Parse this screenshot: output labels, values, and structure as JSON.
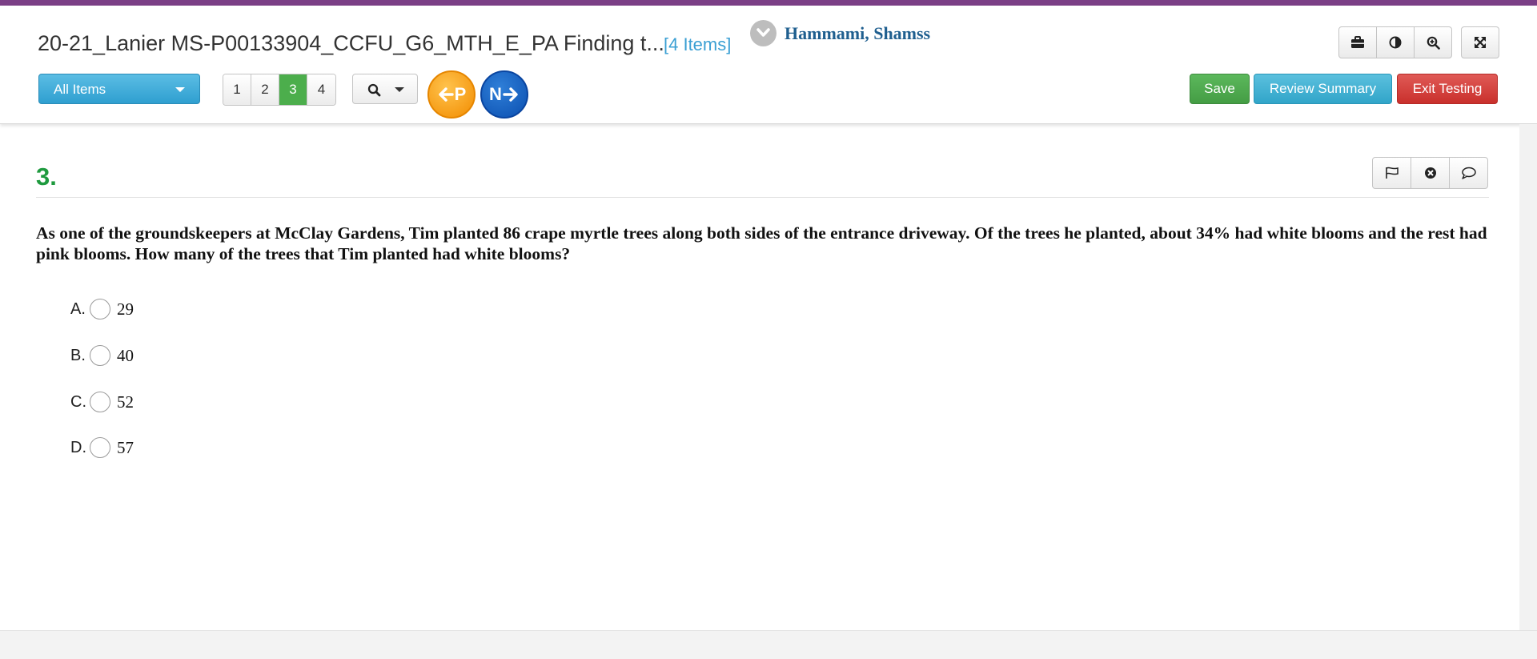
{
  "header": {
    "title": "20-21_Lanier MS-P00133904_CCFU_G6_MTH_E_PA Finding t...",
    "items_count": "[4 Items]",
    "user_name": "Hammami, Shamss",
    "filter_label": "All Items",
    "pages": [
      {
        "label": "1",
        "active": false
      },
      {
        "label": "2",
        "active": false
      },
      {
        "label": "3",
        "active": true
      },
      {
        "label": "4",
        "active": false
      }
    ],
    "prev_label": "P",
    "next_label": "N",
    "save_label": "Save",
    "review_label": "Review Summary",
    "exit_label": "Exit Testing"
  },
  "tools": [
    "briefcase-icon",
    "contrast-icon",
    "zoom-in-icon",
    "fullscreen-icon"
  ],
  "question": {
    "number": "3.",
    "text": "As one of the groundskeepers at McClay Gardens, Tim planted 86 crape myrtle trees along both sides of the entrance driveway. Of the trees he planted, about 34% had white blooms and the rest had pink blooms. How many of the trees that Tim planted had white blooms?",
    "choices": [
      {
        "letter": "A.",
        "value": "29"
      },
      {
        "letter": "B.",
        "value": "40"
      },
      {
        "letter": "C.",
        "value": "52"
      },
      {
        "letter": "D.",
        "value": "57"
      }
    ]
  },
  "colors": {
    "top_stripe": "#7b3f86",
    "question_number": "#1e9a3e",
    "user_name": "#1f5f8f",
    "items_count": "#3a9fd3",
    "save": "#5cb85c",
    "review": "#5bc0de",
    "exit": "#d9534f",
    "prev": "#f28c00",
    "next": "#0b4fb0"
  }
}
